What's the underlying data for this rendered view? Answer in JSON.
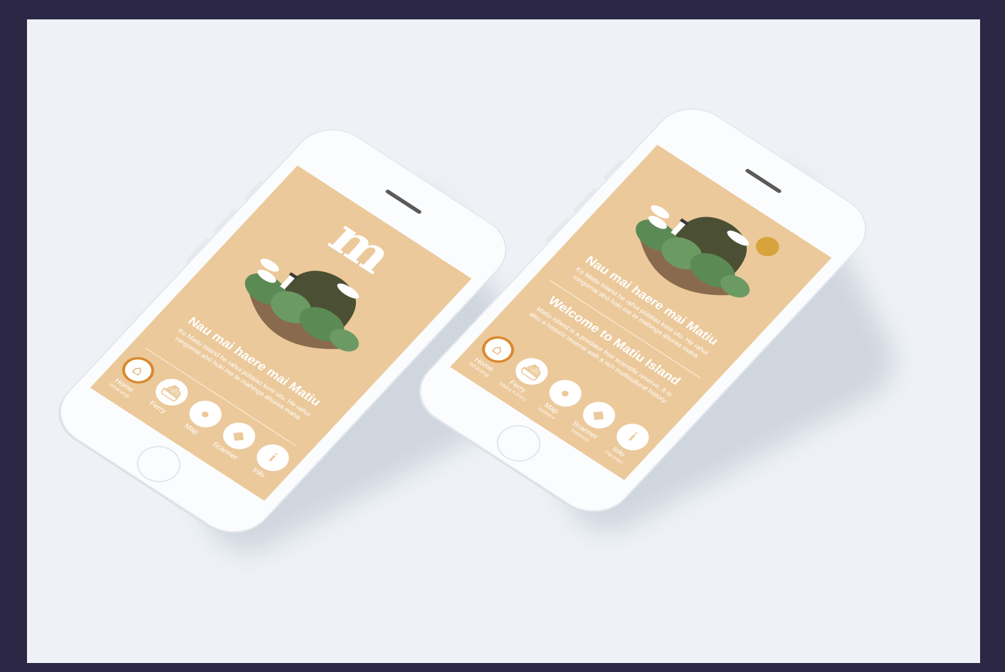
{
  "phones": [
    {
      "logo": "m",
      "headline": "Nau mai haere mai Matiu",
      "subtext": "Ko Matiu Island he rahui pūtaiao kore utu. He rahui rongomai ahō hoki me te mahinga ahurea maha.",
      "welcome": null,
      "tabs": [
        {
          "label": "Home",
          "sub": "Whārangi",
          "icon": "home-icon",
          "active": true
        },
        {
          "label": "Ferry",
          "sub": "",
          "icon": "ferry-icon",
          "active": false
        },
        {
          "label": "Map",
          "sub": "",
          "icon": "map-pin-icon",
          "active": false
        },
        {
          "label": "Scanner",
          "sub": "",
          "icon": "drop-icon",
          "active": false
        },
        {
          "label": "Info",
          "sub": "",
          "icon": "info-icon",
          "active": false
        }
      ]
    },
    {
      "logo": "",
      "headline": "Nau mai haere mai Matiu",
      "subtext": "Ko Matiu Island he rahui pūtaiao kore utu. He rahui rongomai ahō hoki me te mahinga ahurea maha.",
      "welcome": "Welcome to Matiu Island",
      "welcome_text": "Matiu Island is a predator free scientific reserve. It is also a historic reserve with a rich multicultural history.",
      "tabs": [
        {
          "label": "Home",
          "sub": "Whārangi",
          "icon": "home-icon",
          "active": true
        },
        {
          "label": "Ferry",
          "sub": "Waka Kōrero",
          "icon": "ferry-icon",
          "active": false
        },
        {
          "label": "Map",
          "sub": "Mahere",
          "icon": "map-pin-icon",
          "active": false
        },
        {
          "label": "Scanner",
          "sub": "Matawai",
          "icon": "drop-icon",
          "active": false
        },
        {
          "label": "Info",
          "sub": "Pārongo",
          "icon": "info-icon",
          "active": false
        }
      ]
    }
  ],
  "colors": {
    "screen": "#ebc99b",
    "accent": "#d9892f",
    "hill": "#4b4f34",
    "green": "#5c8a55",
    "earth": "#8a6a4d",
    "sun": "#d8a33a"
  }
}
